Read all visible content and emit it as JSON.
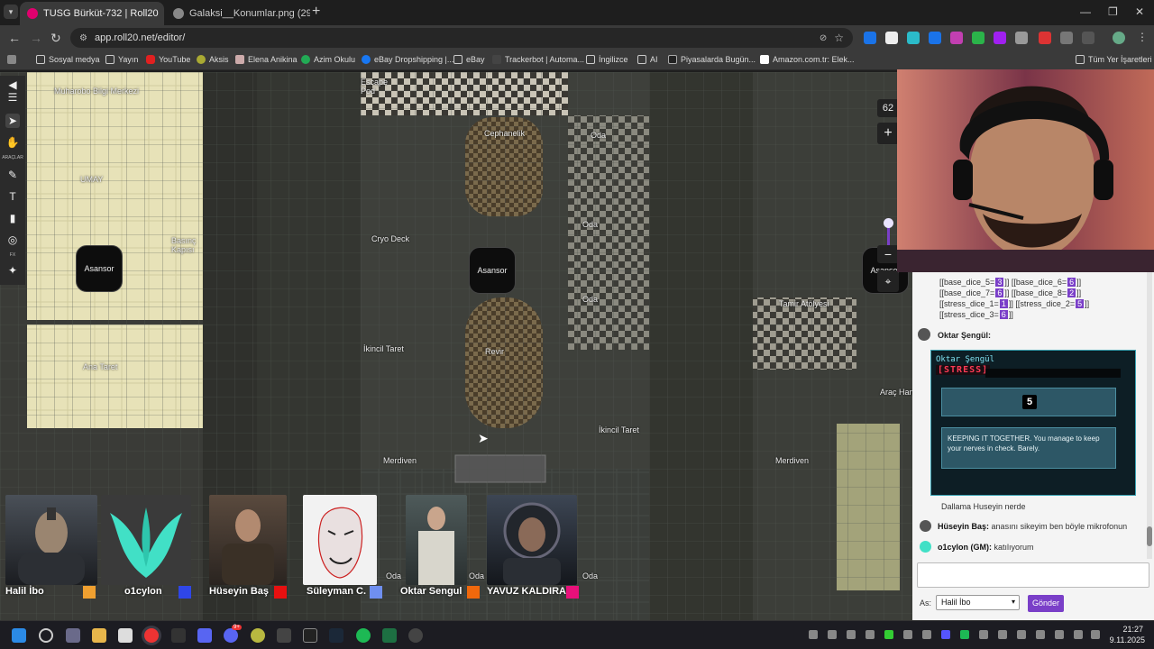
{
  "browser": {
    "tabs": [
      {
        "title": "TUSG Bürküt-732 | Roll20",
        "active": true
      },
      {
        "title": "Galaksi__Konumlar.png (2970",
        "active": false
      }
    ],
    "url": "app.roll20.net/editor/",
    "bookmarks": [
      {
        "label": "Sosyal medya",
        "icon": "folder-icon"
      },
      {
        "label": "Yayın",
        "icon": "folder-icon"
      },
      {
        "label": "YouTube",
        "icon": "youtube-icon"
      },
      {
        "label": "Aksis",
        "icon": "aksis-icon"
      },
      {
        "label": "Elena Anikina",
        "icon": "elena-icon"
      },
      {
        "label": "Azim Okulu",
        "icon": "azim-icon"
      },
      {
        "label": "eBay Dropshipping |...",
        "icon": "facebook-icon"
      },
      {
        "label": "eBay",
        "icon": "folder-icon"
      },
      {
        "label": "Trackerbot | Automa...",
        "icon": "trackerbot-icon"
      },
      {
        "label": "İngilizce",
        "icon": "folder-icon"
      },
      {
        "label": "AI",
        "icon": "folder-icon"
      },
      {
        "label": "Piyasalarda Bugün...",
        "icon": "piyasa-icon"
      },
      {
        "label": "Amazon.com.tr: Elek...",
        "icon": "amazon-icon"
      },
      {
        "label": "Tüm Yer İşaretleri",
        "icon": "folder-icon"
      }
    ]
  },
  "map": {
    "labels": {
      "muharobo": "Muharobo Bilgi Merkezi",
      "umay": "UMAY",
      "escape_pod": "Escape Pod",
      "cephanelik": "Cephanelik",
      "oda1": "Oda",
      "oda2": "Oda",
      "oda3": "Oda",
      "cryo": "Cryo Deck",
      "asansor_left": "Asansor",
      "asansor_mid": "Asansor",
      "asansor_right": "Asansor",
      "basinc": "Basınç Kapısı",
      "tamir": "Tamir Atölyesi",
      "ana_taret": "Ana Taret",
      "ikincil_taret_left": "İkincil Taret",
      "ikincil_taret_right": "İkincil Taret",
      "revir": "Revir",
      "arac_han": "Araç Han",
      "merdiven_left": "Merdiven",
      "merdiven_right": "Merdiven",
      "oda_bottom1": "Oda",
      "oda_bottom2": "Oda",
      "oda_bottom3": "Oda"
    },
    "tools": {
      "section_label": "ARAÇLAR",
      "fx_label": "FX"
    },
    "zoom_level": "62"
  },
  "players": [
    {
      "name": "Halil İbo",
      "color": "#f0a030"
    },
    {
      "name": "o1cylon",
      "color": "#2f46e8"
    },
    {
      "name": "Hüseyin Baş",
      "color": "#e81010"
    },
    {
      "name": "Süleyman C.",
      "color": "#6f8ff0"
    },
    {
      "name": "Oktar Sengul",
      "color": "#f0680c"
    },
    {
      "name": "YAVUZ KALDIRAN",
      "color": "#e8107a"
    }
  ],
  "chat": {
    "dice_lines": [
      {
        "a": "[[base_dice_5=",
        "av": "3",
        "b": "]] [[base_dice_6=",
        "bv": "6",
        "c": "]]"
      },
      {
        "a": "[[base_dice_7=",
        "av": "6",
        "b": "]] [[base_dice_8=",
        "bv": "2",
        "c": "]]"
      },
      {
        "a": "[[stress_dice_1=",
        "av": "1",
        "b": "]] [[stress_dice_2=",
        "bv": "5",
        "c": "]]"
      },
      {
        "a": "[[stress_dice_3=",
        "av": "6",
        "b": "]]",
        "bv": "",
        "c": ""
      }
    ],
    "speaker": "Oktar Şengül:",
    "card": {
      "character": "Oktar Şengül",
      "stat": "[STRESS]",
      "result": "5",
      "description": "KEEPING IT TOGETHER. You manage to keep your nerves in check. Barely."
    },
    "messages": [
      {
        "who": "",
        "text": "Dallama Huseyin nerde"
      },
      {
        "who": "Hüseyin Baş:",
        "text": "anasını sikeyim ben böyle mikrofonun"
      },
      {
        "who": "o1cylon (GM):",
        "text": "katılıyorum"
      }
    ],
    "as_label": "As:",
    "as_value": "Halil İbo",
    "send_label": "Gönder"
  },
  "taskbar": {
    "time": "21:27",
    "date": "9.11.2025",
    "discord_badge": "9+"
  }
}
